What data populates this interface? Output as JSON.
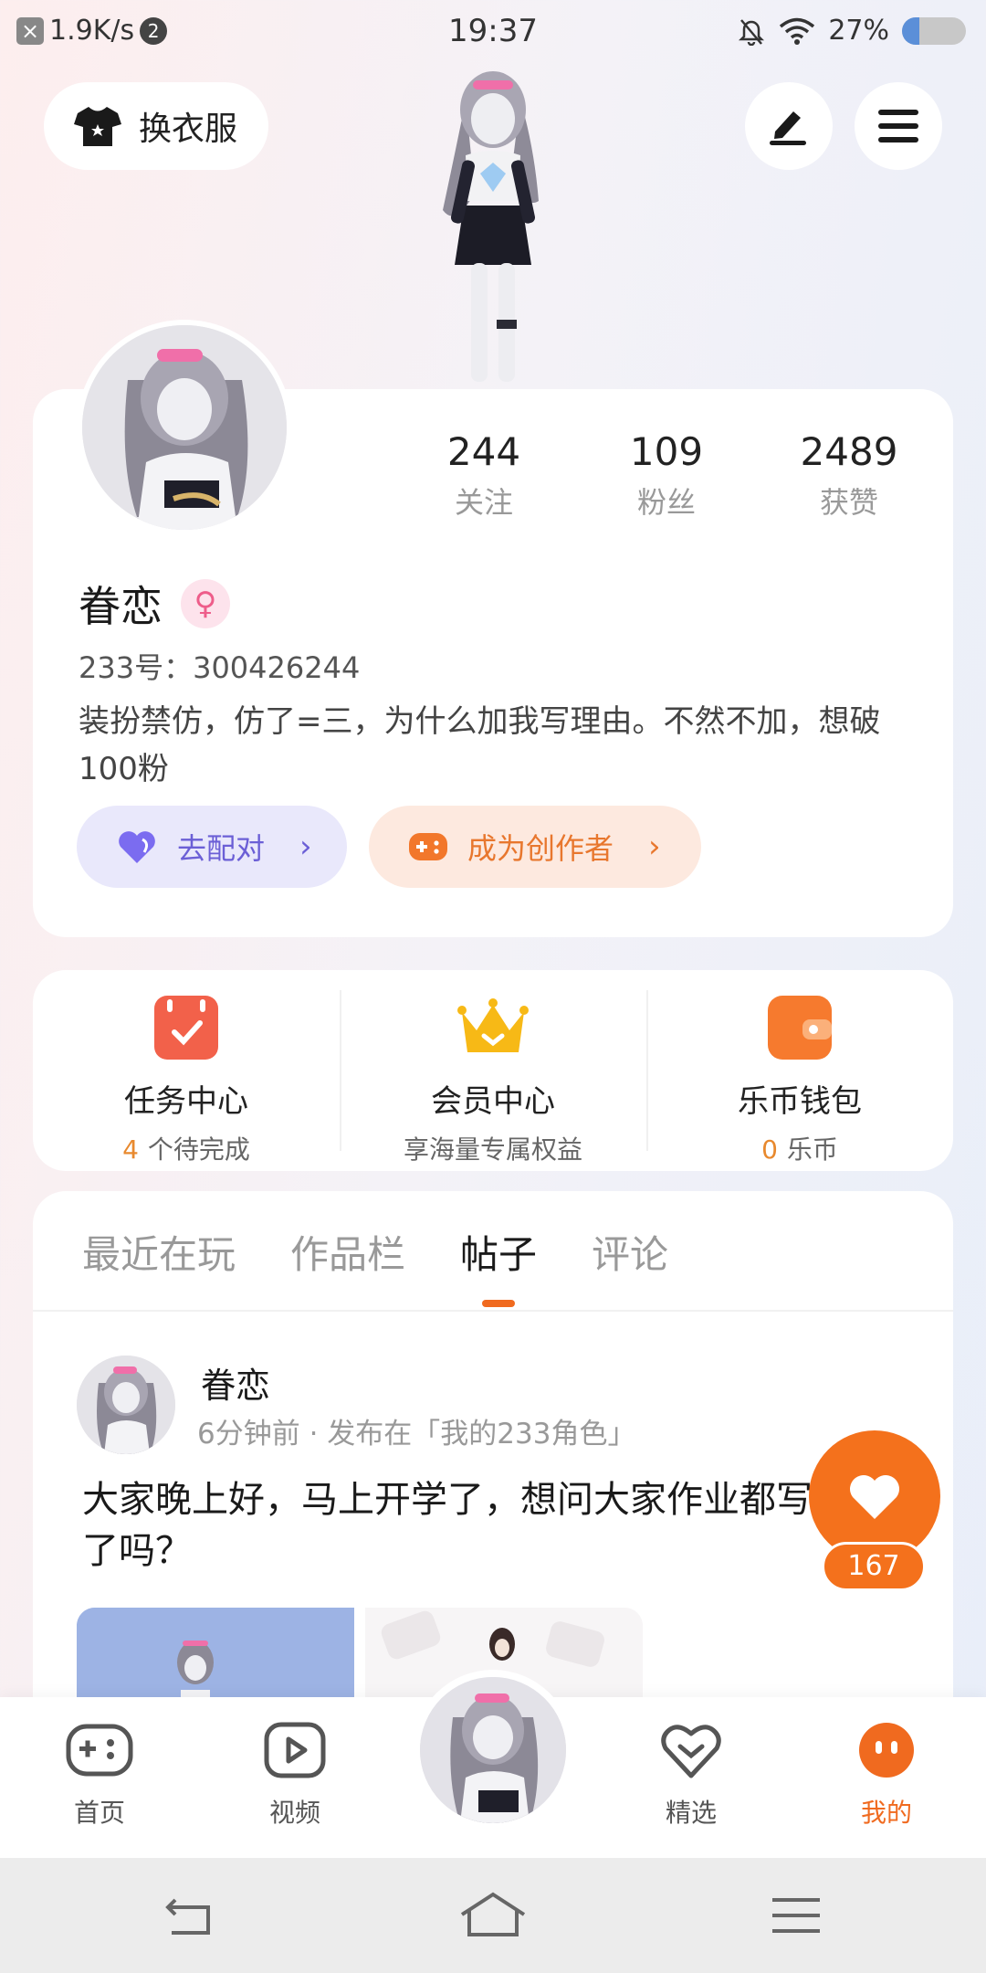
{
  "status_bar": {
    "left_icon": "x-close-icon",
    "net_speed": "1.9K/s",
    "notif_count": "2",
    "time": "19:37",
    "battery_pct_text": "27%",
    "battery_level": 0.27
  },
  "top": {
    "outfit_label": "换衣服",
    "outfit_icon": "tshirt-icon",
    "edit_icon": "pen-icon",
    "menu_icon": "hamburger-menu-icon"
  },
  "profile": {
    "stats": [
      {
        "num": "244",
        "label": "关注"
      },
      {
        "num": "109",
        "label": "粉丝"
      },
      {
        "num": "2489",
        "label": "获赞"
      }
    ],
    "name": "眷恋",
    "gender_symbol": "♀",
    "uid": "233号：300426244",
    "bio": "装扮禁仿，仿了=三，为什么加我写理由。不然不加，想破100粉",
    "match_label": "去配对",
    "creator_label": "成为创作者",
    "chevron": "›"
  },
  "quick": [
    {
      "title": "任务中心",
      "num": "4",
      "sub": "个待完成",
      "color": "#f2614a",
      "icon": "calendar-check-icon"
    },
    {
      "title": "会员中心",
      "num": "",
      "sub": "享海量专属权益",
      "color": "#f7b916",
      "icon": "crown-icon"
    },
    {
      "title": "乐币钱包",
      "num": "0",
      "sub": "乐币",
      "color": "#f67a2e",
      "icon": "wallet-icon"
    }
  ],
  "tabs": [
    "最近在玩",
    "作品栏",
    "帖子",
    "评论"
  ],
  "active_tab": 2,
  "post": {
    "author": "眷恋",
    "meta": "6分钟前 · 发布在「我的233角色」",
    "text": "大家晚上好，马上开学了，想问大家作业都写完了吗？",
    "likes": "167"
  },
  "bottom_nav": [
    {
      "label": "首页",
      "icon": "gamepad-icon"
    },
    {
      "label": "视频",
      "icon": "play-icon"
    },
    {
      "label": "精选",
      "icon": "heart-chat-icon"
    },
    {
      "label": "我的",
      "icon": "face-icon"
    }
  ],
  "colors": {
    "accent": "#f06a1f",
    "match": "#6b5fd6",
    "creator": "#e8772e"
  }
}
